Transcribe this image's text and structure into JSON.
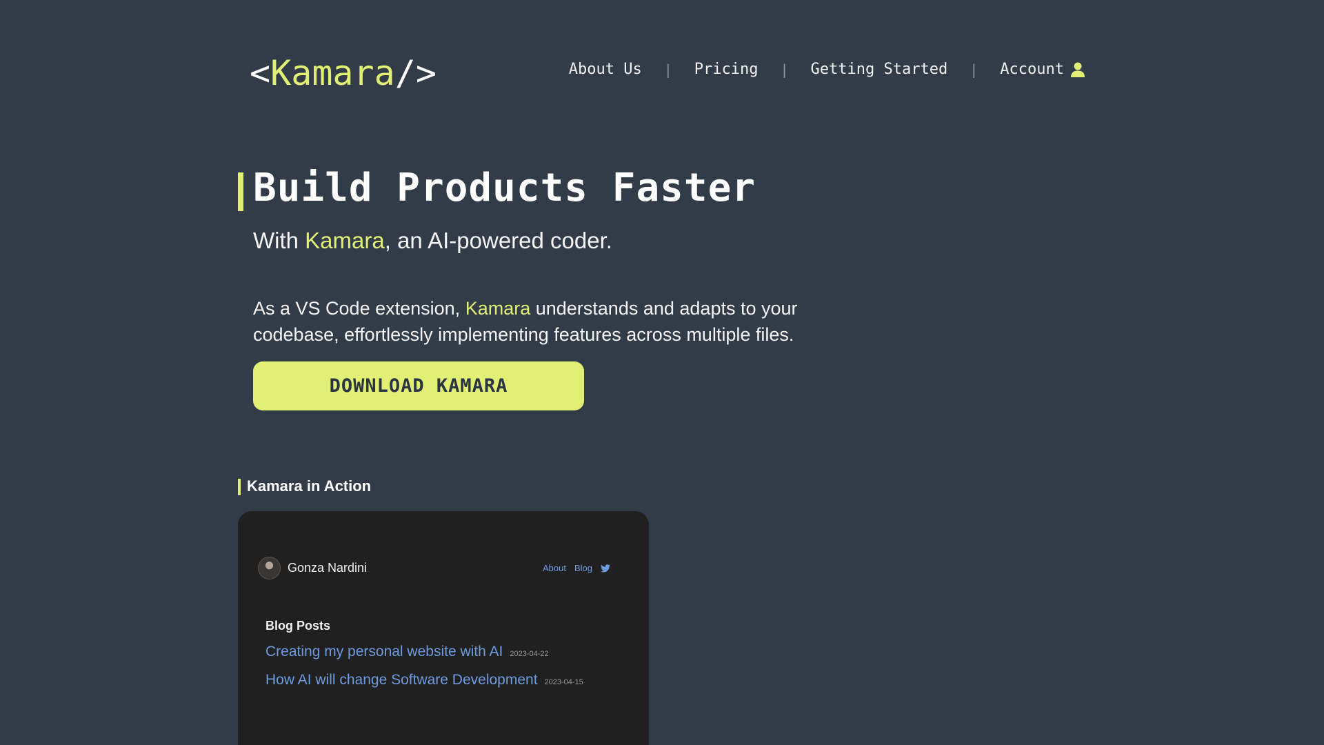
{
  "header": {
    "logo": {
      "open": "<",
      "name": "Kamara",
      "close": "/>"
    },
    "nav": [
      {
        "label": "About Us"
      },
      {
        "label": "Pricing"
      },
      {
        "label": "Getting Started"
      },
      {
        "label": "Account",
        "icon": "user-icon"
      }
    ],
    "separator": "|"
  },
  "hero": {
    "title": "Build Products Faster",
    "subtitle": {
      "before": "With ",
      "brand": "Kamara",
      "after": ", an AI-powered coder."
    },
    "description": {
      "before": "As a VS Code extension, ",
      "brand": "Kamara",
      "after": " understands and adapts to your codebase, effortlessly implementing features across multiple files."
    },
    "cta_label": "DOWNLOAD KAMARA"
  },
  "section": {
    "title": "Kamara in Action"
  },
  "preview": {
    "author": "Gonza Nardini",
    "nav": [
      {
        "label": "About"
      },
      {
        "label": "Blog"
      }
    ],
    "nav_icon": "twitter-icon",
    "blog_title": "Blog Posts",
    "posts": [
      {
        "title": "Creating my personal website with AI",
        "date": "2023-04-22"
      },
      {
        "title": "How AI will change Software Development",
        "date": "2023-04-15"
      }
    ]
  },
  "colors": {
    "background": "#323c49",
    "accent": "#e1ef74",
    "preview_bg": "#202020",
    "link": "#6f9be0"
  }
}
